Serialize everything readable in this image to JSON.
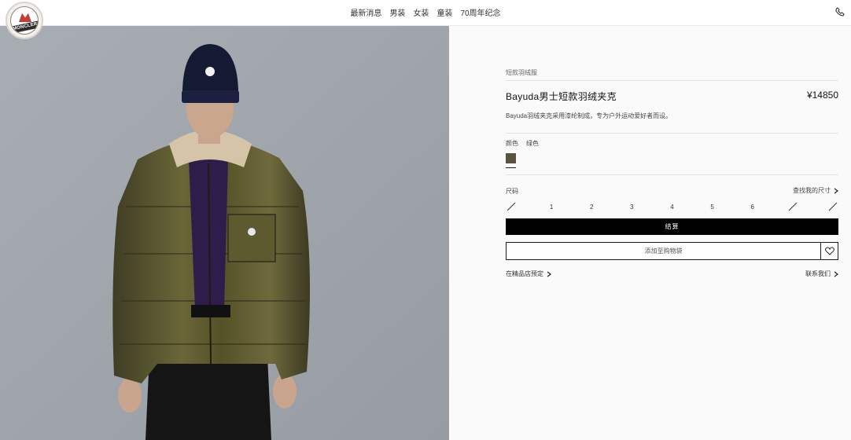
{
  "brand": {
    "logo_text": "MONCLER"
  },
  "nav": {
    "items": [
      "最新消息",
      "男装",
      "女装",
      "童装",
      "70周年纪念"
    ]
  },
  "header": {
    "phone_icon": "phone-icon"
  },
  "product": {
    "breadcrumb": "短款羽绒服",
    "title": "Bayuda男士短款羽绒夹克",
    "price": "¥14850",
    "description": "Bayuda羽绒夹克采用漆纶制成，专为户外运动爱好者而设。",
    "color_label": "颜色",
    "color_value": "绿色",
    "swatch_color": "#5a533f",
    "size_label": "尺码",
    "size_guide": "查找我的尺寸",
    "sizes": [
      "",
      "1",
      "2",
      "3",
      "4",
      "5",
      "6",
      "",
      ""
    ],
    "size_available": [
      false,
      true,
      true,
      true,
      true,
      true,
      true,
      false,
      false
    ],
    "checkout_label": "结算",
    "add_to_bag_label": "添加至购物袋",
    "boutique_label": "在精品店预定",
    "contact_label": "联系我们"
  }
}
